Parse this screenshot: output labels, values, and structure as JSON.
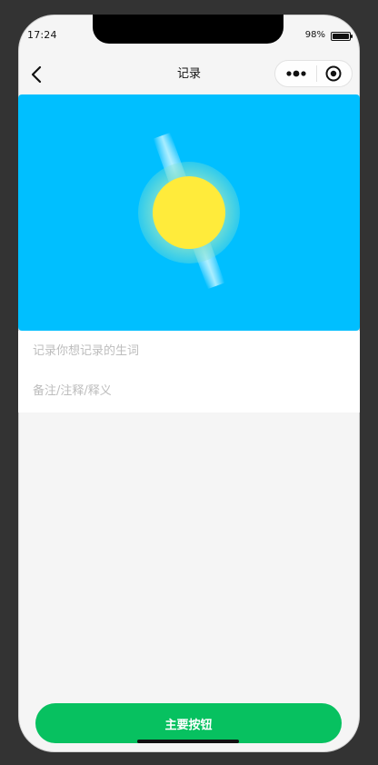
{
  "status_bar": {
    "time": "17:24",
    "battery_percent_text": "98%",
    "battery_level": 0.98
  },
  "nav": {
    "title": "记录",
    "back_icon": "chevron-left-icon",
    "more_icon": "more-dots-icon",
    "close_icon": "target-circle-icon"
  },
  "banner": {
    "background_color": "#00bfff",
    "image": "sun-illustration",
    "sun_color": "#ffeb3b",
    "glow_color": "#7fe0d0"
  },
  "form": {
    "word_field": {
      "value": "",
      "placeholder": "记录你想记录的生词"
    },
    "note_field": {
      "value": "",
      "placeholder": "备注/注释/释义"
    }
  },
  "actions": {
    "primary_label": "主要按钮",
    "primary_color": "#07c160"
  }
}
